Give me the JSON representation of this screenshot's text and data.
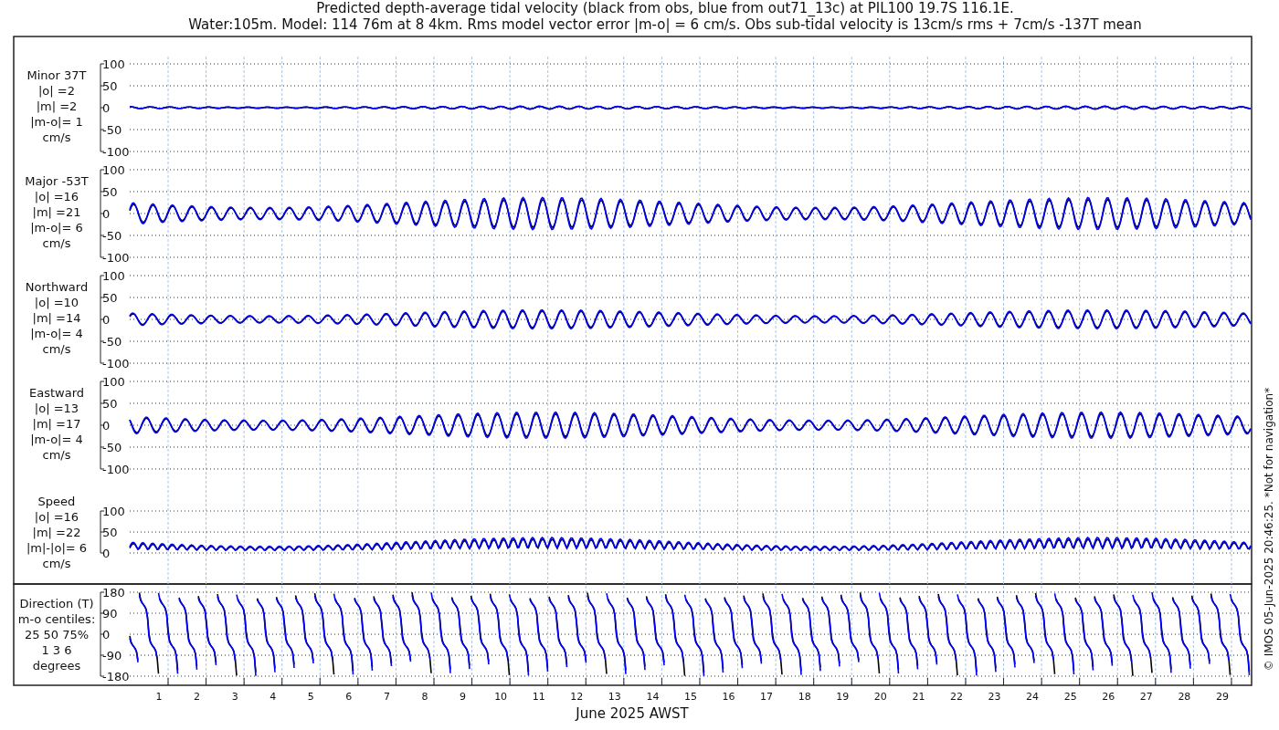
{
  "title": [
    "Predicted depth-average tidal velocity (black from obs, blue from out71_13c) at PIL100 19.7S 116.1E.",
    "Water:105m. Model: 114 76m at 8 4km. Rms model vector error |m-o| = 6 cm/s. Obs sub-tidal velocity is 13cm/s rms + 7cm/s -137T mean"
  ],
  "panels": [
    {
      "kind": "minor",
      "label_lines": [
        "Minor 37T",
        "|o| =2",
        "|m| =2",
        "|m-o|= 1",
        "cm/s"
      ],
      "yticks": [
        "100",
        "50",
        "0",
        "-50",
        "-100"
      ]
    },
    {
      "kind": "major",
      "label_lines": [
        "Major -53T",
        "|o| =16",
        "|m| =21",
        "|m-o|= 6",
        "cm/s"
      ],
      "yticks": [
        "100",
        "50",
        "0",
        "-50",
        "-100"
      ]
    },
    {
      "kind": "northward",
      "label_lines": [
        "Northward",
        "|o| =10",
        "|m| =14",
        "|m-o|= 4",
        "cm/s"
      ],
      "yticks": [
        "100",
        "50",
        "0",
        "-50",
        "-100"
      ]
    },
    {
      "kind": "eastward",
      "label_lines": [
        "Eastward",
        "|o| =13",
        "|m| =17",
        "|m-o|= 4",
        "cm/s"
      ],
      "yticks": [
        "100",
        "50",
        "0",
        "-50",
        "-100"
      ]
    },
    {
      "kind": "speed",
      "label_lines": [
        "Speed",
        "|o| =16",
        "|m| =22",
        "|m|-|o|= 6",
        "cm/s"
      ],
      "yticks": [
        "100",
        "50",
        "0"
      ]
    },
    {
      "kind": "direction",
      "label_lines": [
        "Direction (T)",
        "m-o centiles:",
        "25  50  75%",
        "1  3  6",
        "degrees"
      ],
      "yticks": [
        "180",
        "90",
        "0",
        "-90",
        "-180"
      ]
    }
  ],
  "xticks": [
    "1",
    "2",
    "3",
    "4",
    "5",
    "6",
    "7",
    "8",
    "9",
    "10",
    "11",
    "12",
    "13",
    "14",
    "15",
    "16",
    "17",
    "18",
    "19",
    "20",
    "21",
    "22",
    "23",
    "24",
    "25",
    "26",
    "27",
    "28",
    "29"
  ],
  "xlabel": "June 2025 AWST",
  "footer": "© IMOS 05-Jun-2025 20:46:25. *Not for navigation*"
}
